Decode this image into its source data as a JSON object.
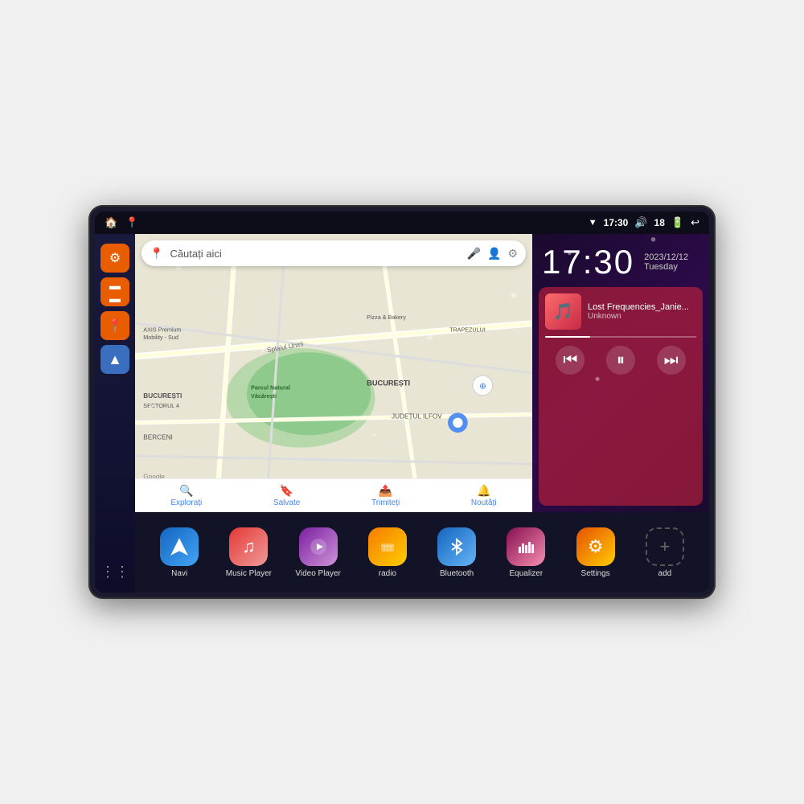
{
  "statusBar": {
    "leftIcons": [
      "🏠",
      "📍"
    ],
    "rightIcons": [
      "wifi",
      "time",
      "volume",
      "battery",
      "back"
    ],
    "time": "17:30",
    "batteryLevel": "18"
  },
  "sidebar": {
    "icons": [
      {
        "name": "settings",
        "symbol": "⚙",
        "label": "settings"
      },
      {
        "name": "folder",
        "symbol": "🗂",
        "label": "folder"
      },
      {
        "name": "map-pin",
        "symbol": "📍",
        "label": "map"
      },
      {
        "name": "navigate",
        "symbol": "▲",
        "label": "navigate"
      },
      {
        "name": "apps",
        "symbol": "⋮⋮",
        "label": "apps"
      }
    ]
  },
  "map": {
    "searchPlaceholder": "Căutați aici",
    "bottomItems": [
      {
        "label": "Explorați",
        "icon": "🔍"
      },
      {
        "label": "Salvate",
        "icon": "🔖"
      },
      {
        "label": "Trimiteți",
        "icon": "📤"
      },
      {
        "label": "Noutăți",
        "icon": "🔔"
      }
    ],
    "labels": {
      "axis": "AXIS Premium Mobility - Sud",
      "pizza": "Pizza & Bakery",
      "trapezului": "TRAPEZULUI",
      "parc": "Parcul Natural Văcărești",
      "bucuresti": "BUCUREȘTI",
      "sectorul": "BUCUREȘTI SECTORUL 4",
      "judetul": "JUDEȚUL ILFOV",
      "berceni": "BERCENI"
    }
  },
  "clock": {
    "time": "17:30",
    "date": "2023/12/12",
    "day": "Tuesday"
  },
  "musicWidget": {
    "title": "Lost Frequencies_Janie...",
    "artist": "Unknown",
    "progressPercent": 30
  },
  "appGrid": {
    "apps": [
      {
        "id": "navi",
        "label": "Navi",
        "iconClass": "app-icon-navi",
        "symbol": "▲"
      },
      {
        "id": "music-player",
        "label": "Music Player",
        "iconClass": "app-icon-music",
        "symbol": "♫"
      },
      {
        "id": "video-player",
        "label": "Video Player",
        "iconClass": "app-icon-video",
        "symbol": "▶"
      },
      {
        "id": "radio",
        "label": "radio",
        "iconClass": "app-icon-radio",
        "symbol": "📻"
      },
      {
        "id": "bluetooth",
        "label": "Bluetooth",
        "iconClass": "app-icon-bluetooth",
        "symbol": "⦿"
      },
      {
        "id": "equalizer",
        "label": "Equalizer",
        "iconClass": "app-icon-eq",
        "symbol": "🎚"
      },
      {
        "id": "settings",
        "label": "Settings",
        "iconClass": "app-icon-settings",
        "symbol": "⚙"
      },
      {
        "id": "add",
        "label": "add",
        "iconClass": "app-icon-add",
        "symbol": "+"
      }
    ]
  }
}
